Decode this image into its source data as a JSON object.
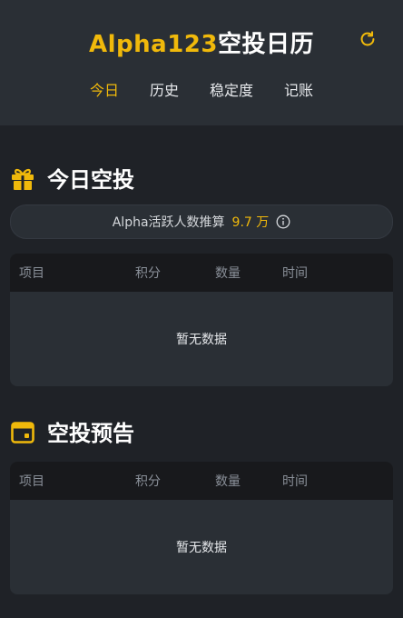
{
  "header": {
    "brand": "Alpha123",
    "title_suffix": "空投日历",
    "tabs": [
      {
        "label": "今日",
        "active": true
      },
      {
        "label": "历史",
        "active": false
      },
      {
        "label": "稳定度",
        "active": false
      },
      {
        "label": "记账",
        "active": false
      }
    ],
    "refresh_icon": "refresh-icon"
  },
  "today": {
    "title": "今日空投",
    "icon": "gift-icon",
    "active_users_label": "Alpha活跃人数推算",
    "active_users_value": "9.7 万",
    "columns": [
      "项目",
      "积分",
      "数量",
      "时间"
    ],
    "empty_text": "暂无数据"
  },
  "forecast": {
    "title": "空投预告",
    "icon": "calendar-icon",
    "columns": [
      "项目",
      "积分",
      "数量",
      "时间"
    ],
    "empty_text": "暂无数据"
  },
  "colors": {
    "accent": "#f0b90b",
    "background": "#1f2227",
    "panel": "#2a2f35",
    "table_header": "#18191c"
  }
}
